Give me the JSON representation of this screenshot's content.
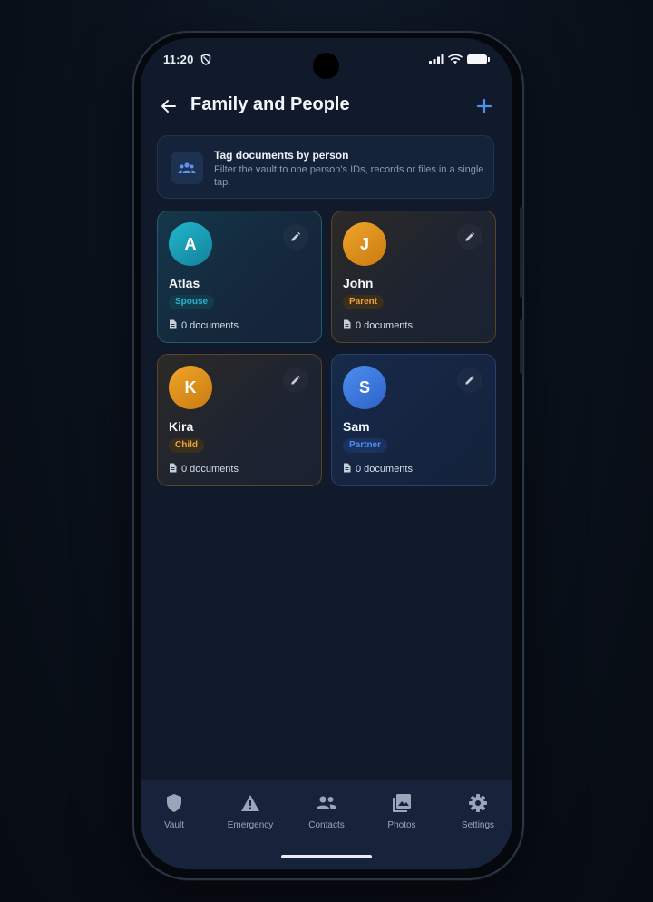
{
  "status_bar": {
    "time": "11:20"
  },
  "header": {
    "title": "Family and People"
  },
  "banner": {
    "title": "Tag documents by person",
    "description": "Filter the vault to one person's IDs, records or files in a single tap."
  },
  "people": [
    {
      "initial": "A",
      "name": "Atlas",
      "relation": "Spouse",
      "documents": "0 documents",
      "accent": "#1fa9c2"
    },
    {
      "initial": "J",
      "name": "John",
      "relation": "Parent",
      "documents": "0 documents",
      "accent": "#e39a23"
    },
    {
      "initial": "K",
      "name": "Kira",
      "relation": "Child",
      "documents": "0 documents",
      "accent": "#e39a23"
    },
    {
      "initial": "S",
      "name": "Sam",
      "relation": "Partner",
      "documents": "0 documents",
      "accent": "#3f7ce2"
    }
  ],
  "bottom_nav": [
    {
      "label": "Vault",
      "icon": "shield-icon"
    },
    {
      "label": "Emergency",
      "icon": "warning-icon"
    },
    {
      "label": "Contacts",
      "icon": "people-icon"
    },
    {
      "label": "Photos",
      "icon": "photos-icon"
    },
    {
      "label": "Settings",
      "icon": "gear-icon"
    }
  ]
}
